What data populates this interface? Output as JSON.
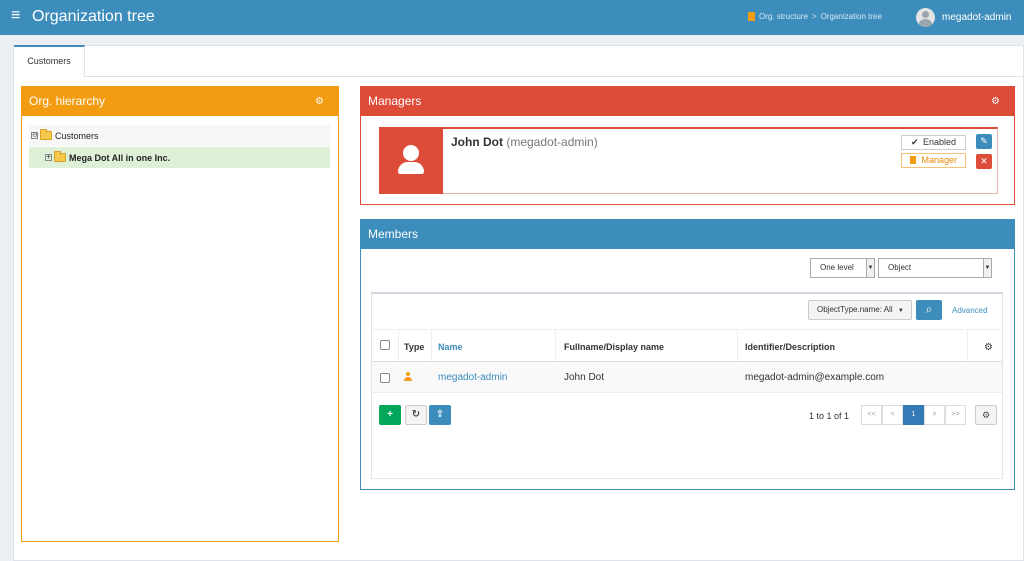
{
  "header": {
    "title": "Organization tree",
    "breadcrumbs": [
      "Org. structure",
      ">",
      "Organization tree"
    ],
    "user": "megadot-admin"
  },
  "tabs": [
    {
      "label": "Customers"
    }
  ],
  "org_panel": {
    "title": "Org. hierarchy",
    "tree": [
      {
        "label": "Customers",
        "expand": "⊖"
      },
      {
        "label": "Mega Dot All in one Inc.",
        "expand": "+"
      }
    ]
  },
  "managers_panel": {
    "title": "Managers",
    "manager": {
      "name": "John Dot",
      "username": "(megadot-admin)",
      "status_label": "Enabled",
      "role_label": "Manager"
    }
  },
  "members_panel": {
    "title": "Members",
    "level_select": "One level",
    "object_select": "Object",
    "type_filter": "ObjectType.name: All",
    "advanced_label": "Advanced",
    "columns": {
      "type": "Type",
      "name": "Name",
      "fullname": "Fullname/Display name",
      "identifier": "Identifier/Description"
    },
    "rows": [
      {
        "name": "megadot-admin",
        "fullname": "John Dot",
        "identifier": "megadot-admin@example.com"
      }
    ],
    "count_text": "1 to 1 of 1",
    "pagination": [
      "<<",
      "<",
      "1",
      ">",
      ">>"
    ]
  },
  "colors": {
    "primary": "#3c8dbc",
    "warning": "#f39c12",
    "danger": "#dd4b39",
    "success": "#00a65a"
  }
}
